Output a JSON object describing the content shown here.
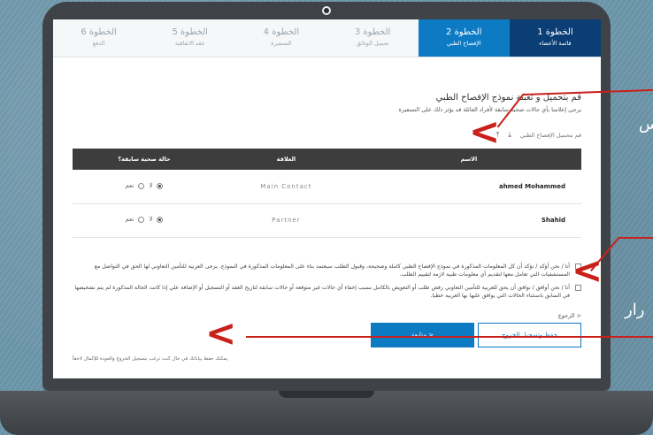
{
  "stepper": {
    "steps": [
      {
        "title": "الخطوة 1",
        "sub": "قائمة الأعضاء",
        "state": "done"
      },
      {
        "title": "الخطوة 2",
        "sub": "الإفصاح الطبي",
        "state": "active"
      },
      {
        "title": "الخطوة 3",
        "sub": "تحميل الوثائق",
        "state": "idle"
      },
      {
        "title": "الخطوة 4",
        "sub": "التسعيرة",
        "state": "idle"
      },
      {
        "title": "الخطوة 5",
        "sub": "عقد الاتفاقية",
        "state": "idle"
      },
      {
        "title": "الخطوة 6",
        "sub": "الدفع",
        "state": "idle"
      }
    ]
  },
  "content": {
    "title": "قم بتحميل و تعبئة نموذج الإفصاح الطبي",
    "subtitle": "يرجى إعلامنا بأي حالات صحية سابقة لأفراد العائلة قد يؤثر ذلك على التسعيرة",
    "upload_label": "قم بتحميل الإفصاح الطبي"
  },
  "table": {
    "headers": [
      "الاسم",
      "العلاقة",
      "حالة صحية سابقة؟"
    ],
    "rows": [
      {
        "name": "ahmed Mohammed",
        "relation": "Main Contact",
        "yes": "نعم",
        "no": "لا"
      },
      {
        "name": "Shahid",
        "relation": "Partner",
        "yes": "نعم",
        "no": "لا"
      }
    ]
  },
  "declarations": [
    "أنا / نحن أؤكد / نؤكد أن كل المعلومات المذكورة في نموذج الإفصاح الطبي كاملة وصحيحة، وقبول الطلب سيعتمد بناء على المعلومات المذكورة في النموذج. يرجى العربية للتأمين التعاوني لها الحق في التواصل مع المستشفيات التي تعامل معها لتقديم أي معلومات طبية لازمة لتقييم الطلب.",
    "أنا / نحن أوافق / نوافق أن يحق للعربية للتأمين التعاوني رفض طلب أو التعويض بالكامل بسبب إخفاء أي حالات غير متوقعة أو حالات سابقة لتاريخ العقد أو التسجيل أو الإضافة علي إذا كانت الحالة المذكورة لم يتم تشخيصها في السابق باستثناء الحالات التي يوافق عليها بها العربية خطيا."
  ],
  "back_label": "< الرجوع",
  "buttons": {
    "continue": "متابعة >",
    "save": "حفظ وتسجيل الخروج"
  },
  "footnote": "يمكنك حفظ بياناتك في حال كنت ترغب بتسجيل الخروج والعودة للإكمال لاحقاً",
  "edge_text": {
    "right_top": "س",
    "right_bottom": "رار"
  },
  "colors": {
    "active_step": "#0d7ac4",
    "done_step": "#0a3e74",
    "annotation": "#c9201a",
    "table_header": "#3d3d3d"
  }
}
